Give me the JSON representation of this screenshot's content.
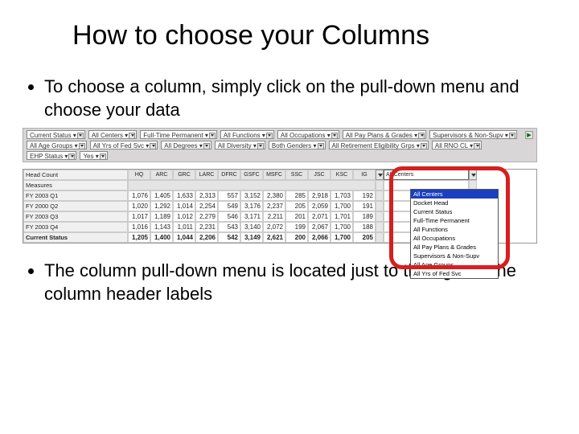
{
  "title": "How to choose your Columns",
  "bullets": {
    "top": "To choose a column, simply click on the pull-down menu and choose your data",
    "bottom": "The column pull-down menu is located just to the right of the column header labels"
  },
  "filters": {
    "row1": [
      "Current Status ▾",
      "All Centers ▾",
      "Full-Time Permanent ▾",
      "All Functions ▾",
      "All Occupations ▾",
      "All Pay Plans & Grades ▾"
    ],
    "row2": [
      "Supervisors & Non-Supv ▾",
      "All Age Groups ▾",
      "All Yrs of Fed Svc ▾",
      "All Degrees ▾",
      "All Diversity ▾",
      "Both Genders ▾"
    ],
    "row3": [
      "All Retirement Eligibility Grps ▾",
      "All RNO CL ▾",
      "EHP Status ▾",
      "Yes ▾"
    ]
  },
  "grid": {
    "measure_label": "Head Count",
    "col_selector_label": "All Centers",
    "row_selector_label": "Measures",
    "headers": [
      "",
      "HQ",
      "ARC",
      "GRC",
      "LARC",
      "DFRC",
      "GSFC",
      "MSFC",
      "SSC",
      "JSC",
      "KSC",
      "IG"
    ],
    "rows": [
      {
        "label": "FY 2003 Q1",
        "v": [
          "1,076",
          "1,405",
          "1,633",
          "2,313",
          "557",
          "3,152",
          "2,380",
          "285",
          "2,918",
          "1,703",
          "192"
        ]
      },
      {
        "label": "FY 2000 Q2",
        "v": [
          "1,020",
          "1,292",
          "1,014",
          "2,254",
          "549",
          "3,176",
          "2,237",
          "205",
          "2,059",
          "1,700",
          "191"
        ]
      },
      {
        "label": "FY 2003 Q3",
        "v": [
          "1,017",
          "1,189",
          "1,012",
          "2,279",
          "546",
          "3,171",
          "2,211",
          "201",
          "2,071",
          "1,701",
          "189"
        ]
      },
      {
        "label": "FY 2003 Q4",
        "v": [
          "1,016",
          "1,143",
          "1,011",
          "2,231",
          "543",
          "3,140",
          "2,072",
          "199",
          "2,067",
          "1,700",
          "188"
        ]
      },
      {
        "label": "Current Status",
        "v": [
          "1,205",
          "1,400",
          "1,044",
          "2,206",
          "542",
          "3,149",
          "2,621",
          "200",
          "2,066",
          "1,700",
          "205"
        ],
        "total": true
      }
    ]
  },
  "menu": {
    "selected": "All Centers",
    "items": [
      "Docket Head",
      "Current Status",
      "Full-Time Permanent",
      "All Functions",
      "All Occupations",
      "All Pay Plans & Grades",
      "Supervisors & Non-Supv",
      "All Age Groups",
      "All Yrs of Fed Svc"
    ]
  }
}
